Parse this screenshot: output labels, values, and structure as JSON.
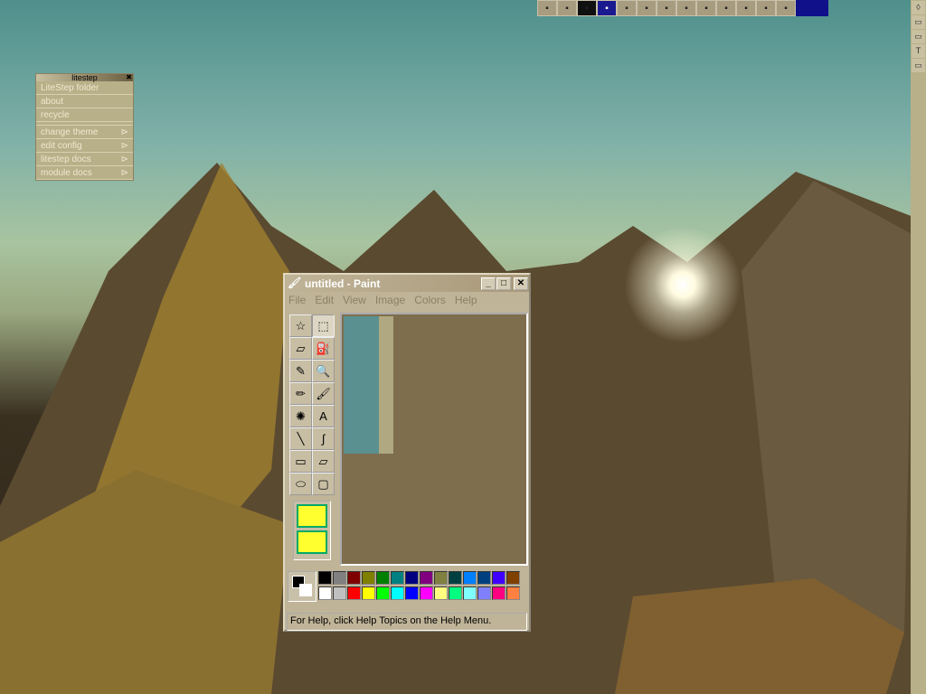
{
  "taskbar": {
    "icons": [
      "windows-logo",
      "folder",
      "explorer",
      "window",
      "notebook",
      "notepad",
      "paint",
      "help",
      "kx",
      "viewer",
      "network",
      "control-panel",
      "search"
    ]
  },
  "litestep": {
    "title": "litestep",
    "close": "✖",
    "items": [
      {
        "label": "LiteStep folder"
      },
      {
        "label": "about"
      },
      {
        "label": "recycle"
      },
      {
        "label": "change theme",
        "sub": "⊳"
      },
      {
        "label": "edit config",
        "sub": "⊳"
      },
      {
        "label": "litestep docs",
        "sub": "⊳"
      },
      {
        "label": "module docs",
        "sub": "⊳"
      }
    ]
  },
  "paint": {
    "title": "untitled - Paint",
    "minimize": "_",
    "maximize": "□",
    "close": "✕",
    "menu": [
      "File",
      "Edit",
      "View",
      "Image",
      "Colors",
      "Help"
    ],
    "tools": [
      {
        "name": "free-select",
        "g": "☆"
      },
      {
        "name": "select",
        "g": "⬚"
      },
      {
        "name": "eraser",
        "g": "▱"
      },
      {
        "name": "fill",
        "g": "⛽"
      },
      {
        "name": "color-picker",
        "g": "✎"
      },
      {
        "name": "magnifier",
        "g": "🔍"
      },
      {
        "name": "pencil",
        "g": "✏"
      },
      {
        "name": "brush",
        "g": "🖌"
      },
      {
        "name": "airbrush",
        "g": "✺"
      },
      {
        "name": "text",
        "g": "A"
      },
      {
        "name": "line",
        "g": "╲"
      },
      {
        "name": "curve",
        "g": "∫"
      },
      {
        "name": "rectangle",
        "g": "▭"
      },
      {
        "name": "polygon",
        "g": "▱"
      },
      {
        "name": "ellipse",
        "g": "⬭"
      },
      {
        "name": "rounded-rectangle",
        "g": "▢"
      }
    ],
    "palette": [
      "#000000",
      "#808080",
      "#800000",
      "#808000",
      "#008000",
      "#008080",
      "#000080",
      "#800080",
      "#808040",
      "#004040",
      "#0080ff",
      "#004080",
      "#4000ff",
      "#804000",
      "#ffffff",
      "#c0c0c0",
      "#ff0000",
      "#ffff00",
      "#00ff00",
      "#00ffff",
      "#0000ff",
      "#ff00ff",
      "#ffff80",
      "#00ff80",
      "#80ffff",
      "#8080ff",
      "#ff0080",
      "#ff8040"
    ],
    "foreground": "#000000",
    "background": "#ffffff",
    "status": "For Help, click Help Topics on the Help Menu."
  }
}
